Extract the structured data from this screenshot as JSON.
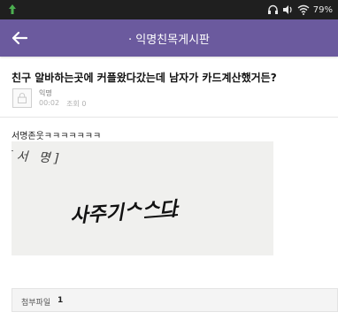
{
  "status_bar": {
    "battery": "79%",
    "icons": [
      "notification-icon",
      "headphones-icon",
      "volume-icon",
      "wifi-icon",
      "battery-icon"
    ]
  },
  "app_bar": {
    "title": "· 익명친목게시판",
    "back_icon": "arrow-left-icon",
    "color": "#6b5a9e"
  },
  "post": {
    "title": "친구 알바하는곳에 커플왔다갔는데 남자가 카드계산했거든?",
    "author": "익명",
    "time": "00:02",
    "views": "조회 0",
    "body": "서명존웃ㅋㅋㅋㅋㅋㅋㅋ",
    "image": {
      "printed_text": "[서 명]",
      "signature_text": "사주기ᄉᄉ다"
    }
  },
  "attachments": {
    "label": "첨부파일",
    "count": "1"
  }
}
